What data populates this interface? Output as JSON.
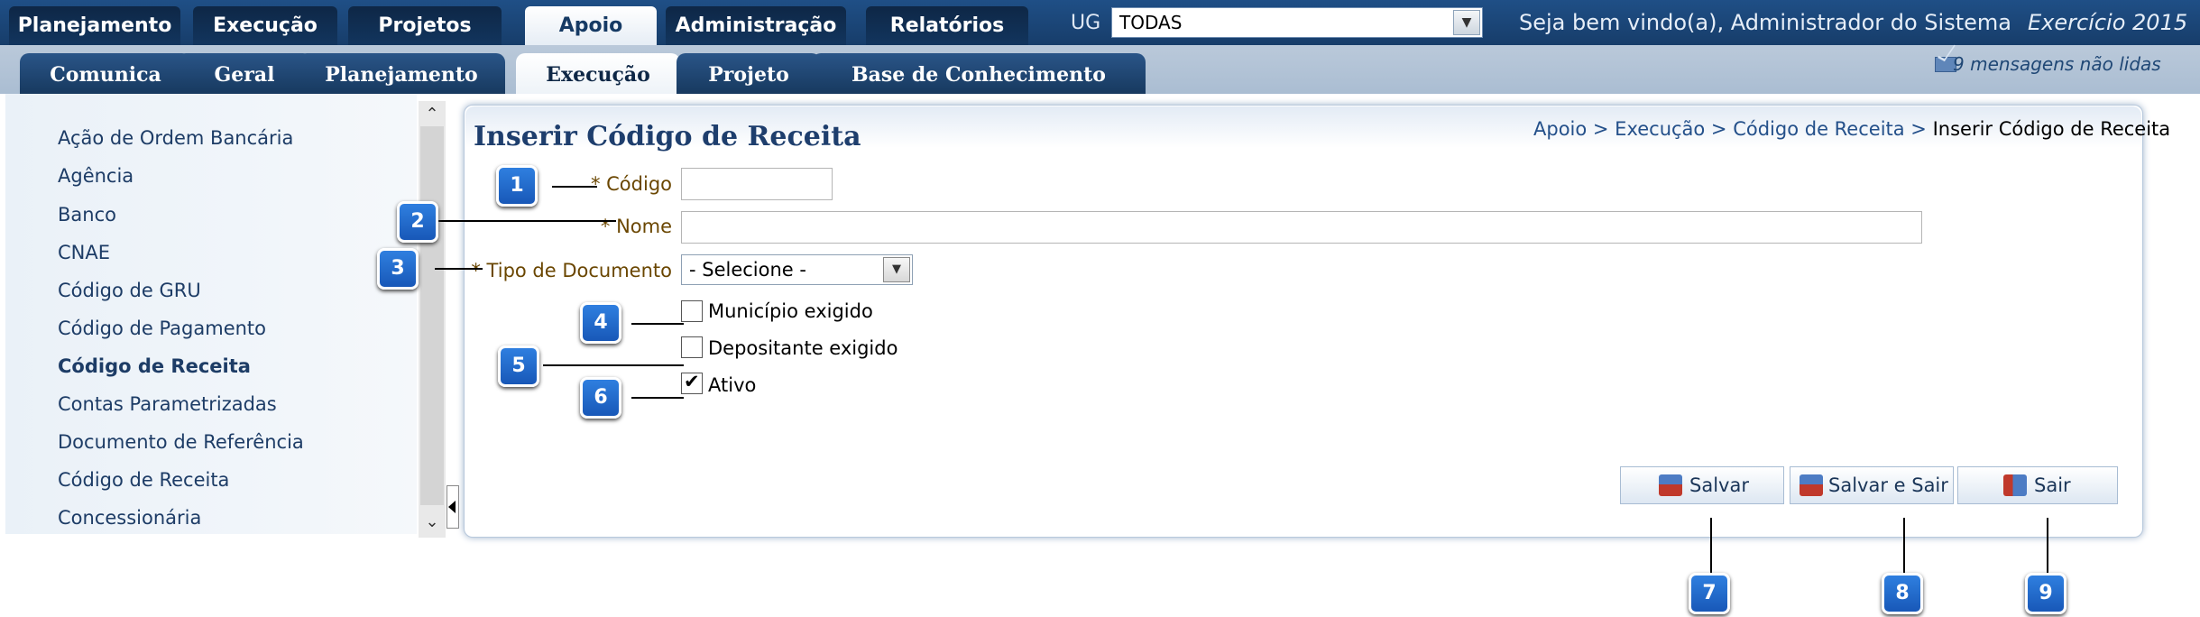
{
  "top_nav": {
    "tabs": [
      {
        "label": "Planejamento"
      },
      {
        "label": "Execução"
      },
      {
        "label": "Projetos"
      },
      {
        "label": "Apoio",
        "active": true
      },
      {
        "label": "Administração"
      },
      {
        "label": "Relatórios"
      }
    ],
    "ug_label": "UG",
    "ug_value": "TODAS",
    "welcome": "Seja bem vindo(a), Administrador do Sistema",
    "exercicio": "Exercício 2015"
  },
  "sub_nav": {
    "tabs": [
      {
        "label": "Comunica"
      },
      {
        "label": "Geral"
      },
      {
        "label": "Planejamento"
      },
      {
        "label": "Execução",
        "active": true
      },
      {
        "label": "Projeto"
      },
      {
        "label": "Base de Conhecimento"
      }
    ],
    "messages": "9 mensagens não lidas"
  },
  "sidebar": {
    "items": [
      {
        "label": "Ação de Ordem Bancária"
      },
      {
        "label": "Agência"
      },
      {
        "label": "Banco"
      },
      {
        "label": "CNAE"
      },
      {
        "label": "Código de GRU"
      },
      {
        "label": "Código de Pagamento"
      },
      {
        "label": "Código de Receita",
        "active": true
      },
      {
        "label": "Contas Parametrizadas"
      },
      {
        "label": "Documento de Referência"
      },
      {
        "label": "Código de Receita"
      },
      {
        "label": "Concessionária"
      }
    ]
  },
  "main": {
    "title": "Inserir Código de Receita",
    "breadcrumb": {
      "path": "Apoio > Execução > Código de Receita > ",
      "current": "Inserir Código de Receita"
    },
    "form": {
      "codigo_label": "* Código",
      "codigo_value": "",
      "nome_label": "* Nome",
      "nome_value": "",
      "tipo_label": "* Tipo de Documento",
      "tipo_value": "- Selecione -",
      "municipio_label": "Município exigido",
      "municipio_checked": false,
      "depositante_label": "Depositante exigido",
      "depositante_checked": false,
      "ativo_label": "Ativo",
      "ativo_checked": true
    },
    "buttons": {
      "salvar": "Salvar",
      "salvar_sair": "Salvar e Sair",
      "sair": "Sair"
    }
  },
  "callouts": [
    "1",
    "2",
    "3",
    "4",
    "5",
    "6",
    "7",
    "8",
    "9"
  ],
  "colors": {
    "nav_dark": "#173d6a",
    "accent_blue": "#1858b8",
    "label_brown": "#6a4600"
  }
}
